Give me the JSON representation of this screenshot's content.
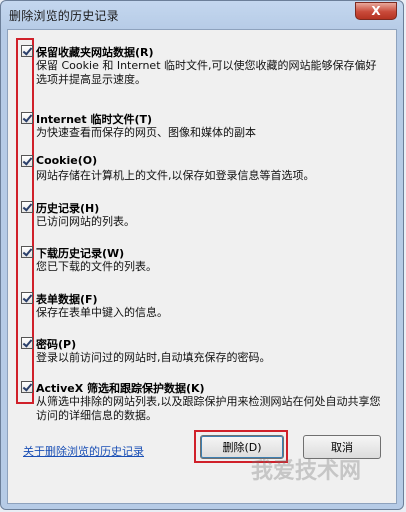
{
  "window": {
    "title": "删除浏览的历史记录",
    "close_label": "X"
  },
  "items": [
    {
      "title": "保留收藏夹网站数据(R)",
      "desc": "保留 Cookie 和 Internet 临时文件,可以使您收藏的网站能够保存偏好选项并提高显示速度。",
      "checked": true
    },
    {
      "title": "Internet 临时文件(T)",
      "desc": "为快速查看而保存的网页、图像和媒体的副本",
      "checked": true
    },
    {
      "title": "Cookie(O)",
      "desc": "网站存储在计算机上的文件,以保存如登录信息等首选项。",
      "checked": true
    },
    {
      "title": "历史记录(H)",
      "desc": "已访问网站的列表。",
      "checked": true
    },
    {
      "title": "下载历史记录(W)",
      "desc": "您已下载的文件的列表。",
      "checked": true
    },
    {
      "title": "表单数据(F)",
      "desc": "保存在表单中键入的信息。",
      "checked": true
    },
    {
      "title": "密码(P)",
      "desc": "登录以前访问过的网站时,自动填充保存的密码。",
      "checked": true
    },
    {
      "title": "ActiveX 筛选和跟踪保护数据(K)",
      "desc": "从筛选中排除的网站列表,以及跟踪保护用来检测网站在何处自动共享您访问的详细信息的数据。",
      "checked": true
    }
  ],
  "footer": {
    "link_label": "关于删除浏览的历史记录",
    "delete_label": "删除(D)",
    "cancel_label": "取消"
  },
  "watermark": "我爱技术网"
}
